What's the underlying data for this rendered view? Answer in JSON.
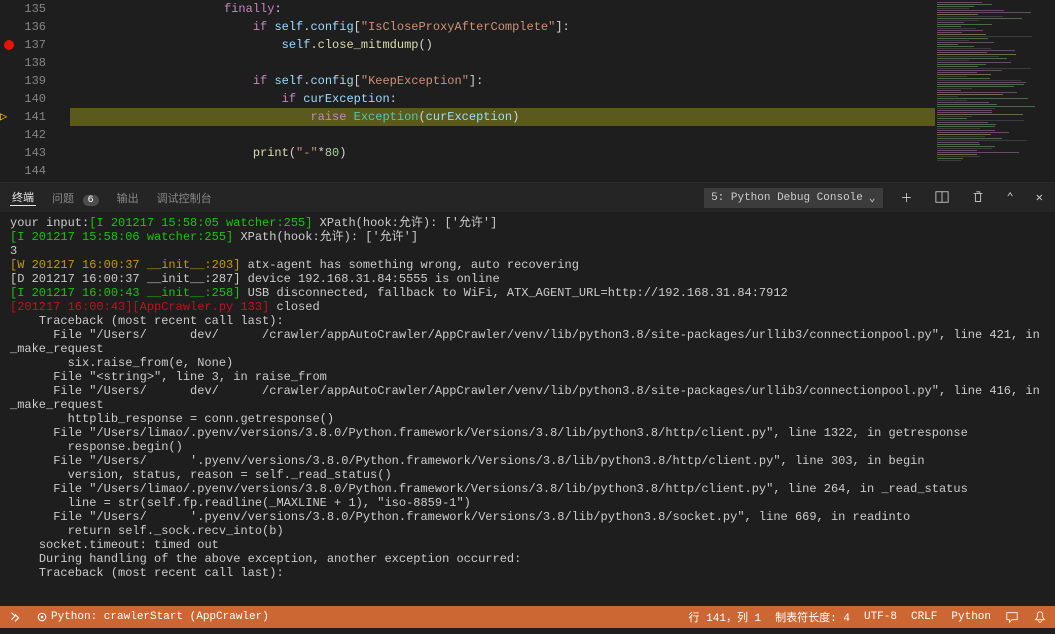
{
  "editor": {
    "lines": [
      {
        "num": "135",
        "bp": false,
        "arrow": false,
        "hl": false,
        "code": [
          {
            "t": "                    ",
            "c": ""
          },
          {
            "t": "finally",
            "c": "kw"
          },
          {
            "t": ":",
            "c": "pu"
          }
        ]
      },
      {
        "num": "136",
        "bp": false,
        "arrow": false,
        "hl": false,
        "code": [
          {
            "t": "                        ",
            "c": ""
          },
          {
            "t": "if",
            "c": "kw"
          },
          {
            "t": " ",
            "c": ""
          },
          {
            "t": "self",
            "c": "va"
          },
          {
            "t": ".",
            "c": "pu"
          },
          {
            "t": "config",
            "c": "va"
          },
          {
            "t": "[",
            "c": "pu"
          },
          {
            "t": "\"IsCloseProxyAfterComplete\"",
            "c": "st"
          },
          {
            "t": "]:",
            "c": "pu"
          }
        ]
      },
      {
        "num": "137",
        "bp": true,
        "arrow": false,
        "hl": false,
        "code": [
          {
            "t": "                            ",
            "c": ""
          },
          {
            "t": "self",
            "c": "va"
          },
          {
            "t": ".",
            "c": "pu"
          },
          {
            "t": "close_mitmdump",
            "c": "fn"
          },
          {
            "t": "()",
            "c": "pu"
          }
        ]
      },
      {
        "num": "138",
        "bp": false,
        "arrow": false,
        "hl": false,
        "code": []
      },
      {
        "num": "139",
        "bp": false,
        "arrow": false,
        "hl": false,
        "code": [
          {
            "t": "                        ",
            "c": ""
          },
          {
            "t": "if",
            "c": "kw"
          },
          {
            "t": " ",
            "c": ""
          },
          {
            "t": "self",
            "c": "va"
          },
          {
            "t": ".",
            "c": "pu"
          },
          {
            "t": "config",
            "c": "va"
          },
          {
            "t": "[",
            "c": "pu"
          },
          {
            "t": "\"KeepException\"",
            "c": "st"
          },
          {
            "t": "]:",
            "c": "pu"
          }
        ]
      },
      {
        "num": "140",
        "bp": false,
        "arrow": false,
        "hl": false,
        "code": [
          {
            "t": "                            ",
            "c": ""
          },
          {
            "t": "if",
            "c": "kw"
          },
          {
            "t": " ",
            "c": ""
          },
          {
            "t": "curException",
            "c": "va"
          },
          {
            "t": ":",
            "c": "pu"
          }
        ]
      },
      {
        "num": "141",
        "bp": false,
        "arrow": true,
        "hl": true,
        "code": [
          {
            "t": "                                ",
            "c": ""
          },
          {
            "t": "raise",
            "c": "kw"
          },
          {
            "t": " ",
            "c": ""
          },
          {
            "t": "Exception",
            "c": "cl"
          },
          {
            "t": "(",
            "c": "pu"
          },
          {
            "t": "curException",
            "c": "va"
          },
          {
            "t": ")",
            "c": "pu"
          }
        ]
      },
      {
        "num": "142",
        "bp": false,
        "arrow": false,
        "hl": false,
        "code": []
      },
      {
        "num": "143",
        "bp": false,
        "arrow": false,
        "hl": false,
        "code": [
          {
            "t": "                        ",
            "c": ""
          },
          {
            "t": "print",
            "c": "fn"
          },
          {
            "t": "(",
            "c": "pu"
          },
          {
            "t": "\"-\"",
            "c": "st"
          },
          {
            "t": "*",
            "c": "pu"
          },
          {
            "t": "80",
            "c": "nu"
          },
          {
            "t": ")",
            "c": "pu"
          }
        ]
      },
      {
        "num": "144",
        "bp": false,
        "arrow": false,
        "hl": false,
        "code": []
      }
    ]
  },
  "panel": {
    "tabs": {
      "terminal": "终端",
      "problems": "问题",
      "problems_count": "6",
      "output": "输出",
      "debug_console": "调试控制台"
    },
    "console_select": "5: Python Debug Console"
  },
  "terminal_lines": [
    {
      "c": "t-gray",
      "t": "your input:"
    },
    {
      "pre": "your input:",
      "c": "t-green",
      "t": "[I 201217 15:58:05 watcher:255]",
      "suf": " XPath(hook:允许): ['允许']"
    },
    {
      "c": "t-green",
      "t": "[I 201217 15:58:06 watcher:255]",
      "suf": " XPath(hook:允许): ['允许']"
    },
    {
      "c": "t-gray",
      "t": "3"
    },
    {
      "c": "t-yellow",
      "t": "[W 201217 16:00:37 __init__:203]",
      "suf": " atx-agent has something wrong, auto recovering"
    },
    {
      "c": "t-gray",
      "t": "[D 201217 16:00:37 __init__:287] device 192.168.31.84:5555 is online"
    },
    {
      "c": "t-green",
      "t": "[I 201217 16:00:43 __init__:258]",
      "suf": " USB disconnected, fallback to WiFi, ATX_AGENT_URL=http://192.168.31.84:7912"
    },
    {
      "c": "t-red",
      "t": "[201217 16:00:43][AppCrawler.py 133]",
      "suf": " closed"
    },
    {
      "c": "t-gray",
      "t": "    Traceback (most recent call last):"
    },
    {
      "c": "t-gray",
      "t": "      File \"/Users/      dev/      /crawler/appAutoCrawler/AppCrawler/venv/lib/python3.8/site-packages/urllib3/connectionpool.py\", line 421, in _make_request"
    },
    {
      "c": "t-gray",
      "t": "        six.raise_from(e, None)"
    },
    {
      "c": "t-gray",
      "t": "      File \"<string>\", line 3, in raise_from"
    },
    {
      "c": "t-gray",
      "t": "      File \"/Users/      dev/      /crawler/appAutoCrawler/AppCrawler/venv/lib/python3.8/site-packages/urllib3/connectionpool.py\", line 416, in _make_request"
    },
    {
      "c": "t-gray",
      "t": "        httplib_response = conn.getresponse()"
    },
    {
      "c": "t-gray",
      "t": "      File \"/Users/limao/.pyenv/versions/3.8.0/Python.framework/Versions/3.8/lib/python3.8/http/client.py\", line 1322, in getresponse"
    },
    {
      "c": "t-gray",
      "t": "        response.begin()"
    },
    {
      "c": "t-gray",
      "t": "      File \"/Users/      '.pyenv/versions/3.8.0/Python.framework/Versions/3.8/lib/python3.8/http/client.py\", line 303, in begin"
    },
    {
      "c": "t-gray",
      "t": "        version, status, reason = self._read_status()"
    },
    {
      "c": "t-gray",
      "t": "      File \"/Users/limao/.pyenv/versions/3.8.0/Python.framework/Versions/3.8/lib/python3.8/http/client.py\", line 264, in _read_status"
    },
    {
      "c": "t-gray",
      "t": "        line = str(self.fp.readline(_MAXLINE + 1), \"iso-8859-1\")"
    },
    {
      "c": "t-gray",
      "t": "      File \"/Users/      '.pyenv/versions/3.8.0/Python.framework/Versions/3.8/lib/python3.8/socket.py\", line 669, in readinto"
    },
    {
      "c": "t-gray",
      "t": "        return self._sock.recv_into(b)"
    },
    {
      "c": "t-gray",
      "t": "    socket.timeout: timed out"
    },
    {
      "c": "t-gray",
      "t": ""
    },
    {
      "c": "t-gray",
      "t": "    During handling of the above exception, another exception occurred:"
    },
    {
      "c": "t-gray",
      "t": ""
    },
    {
      "c": "t-gray",
      "t": "    Traceback (most recent call last):"
    }
  ],
  "statusbar": {
    "branch_icon": "⎇",
    "launch": "Python: crawlerStart (AppCrawler)",
    "line_col": "行 141，列 1",
    "tab_size": "制表符长度: 4",
    "encoding": "UTF-8",
    "eol": "CRLF",
    "language": "Python"
  }
}
